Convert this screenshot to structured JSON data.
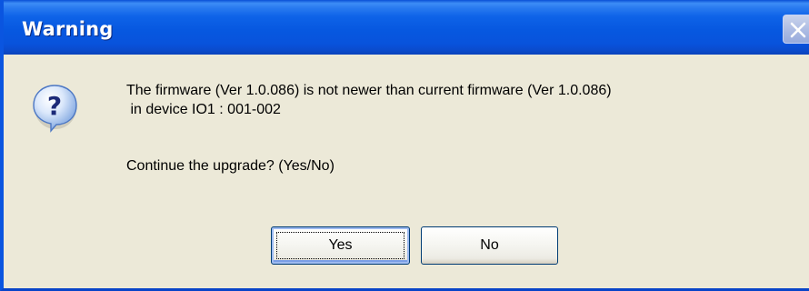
{
  "window": {
    "title": "Warning"
  },
  "icons": {
    "message_icon": "question-icon",
    "close_icon": "close-icon"
  },
  "message": {
    "line1": "The firmware (Ver 1.0.086) is not newer than current firmware (Ver 1.0.086)",
    "line2": " in device IO1 : 001-002",
    "line3": "Continue the upgrade? (Yes/No)"
  },
  "buttons": {
    "yes_label": "Yes",
    "no_label": "No"
  },
  "colors": {
    "title_bar": "#0758e0",
    "dialog_background": "#ece9d8",
    "button_border": "#003c74"
  }
}
